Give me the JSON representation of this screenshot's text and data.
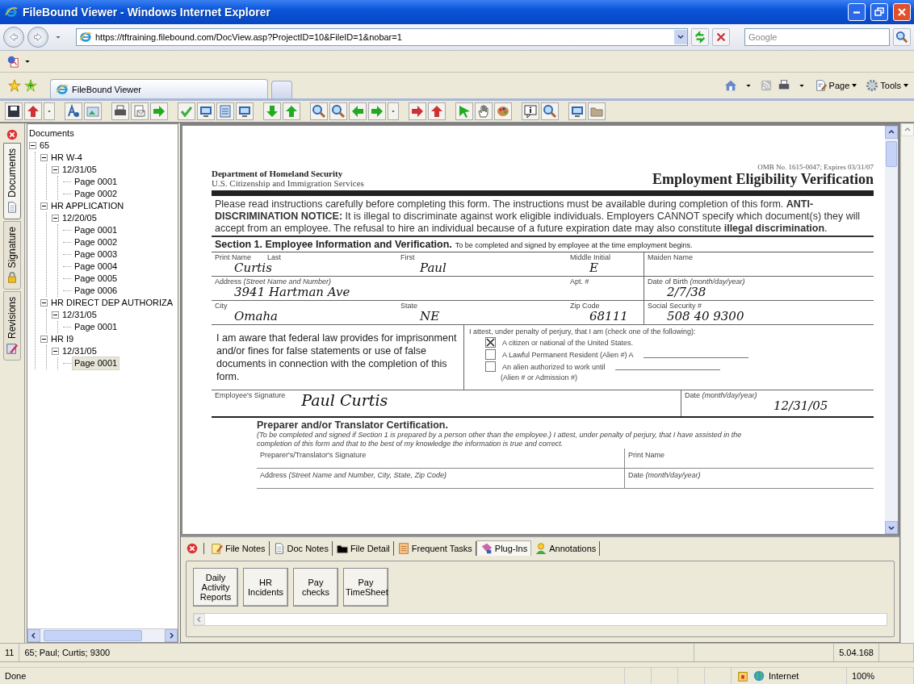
{
  "window": {
    "title": "FileBound Viewer - Windows Internet Explorer"
  },
  "address_bar": {
    "url": "https://tftraining.filebound.com/DocView.asp?ProjectID=10&FileID=1&nobar=1"
  },
  "search": {
    "placeholder": "Google"
  },
  "browser_tabs": [
    {
      "label": "FileBound Viewer",
      "selected": true
    }
  ],
  "command_bar": [
    {
      "label": "Page"
    },
    {
      "label": "Tools"
    }
  ],
  "side_tabs": [
    {
      "label": "Documents",
      "selected": true,
      "kind": "doc"
    },
    {
      "label": "Signature",
      "selected": false,
      "kind": "lock"
    },
    {
      "label": "Revisions",
      "selected": false,
      "kind": "pen"
    }
  ],
  "tree": {
    "title": "Documents",
    "items": [
      {
        "label": "65",
        "expanded": true,
        "children": [
          {
            "label": "HR W-4",
            "expanded": true,
            "children": [
              {
                "label": "12/31/05",
                "expanded": true,
                "children": [
                  {
                    "label": "Page 0001",
                    "selected": false
                  },
                  {
                    "label": "Page 0002",
                    "selected": false
                  }
                ]
              }
            ]
          },
          {
            "label": "HR APPLICATION",
            "expanded": true,
            "children": [
              {
                "label": "12/20/05",
                "expanded": true,
                "children": [
                  {
                    "label": "Page 0001",
                    "selected": false
                  },
                  {
                    "label": "Page 0002",
                    "selected": false
                  },
                  {
                    "label": "Page 0003",
                    "selected": false
                  },
                  {
                    "label": "Page 0004",
                    "selected": false
                  },
                  {
                    "label": "Page 0005",
                    "selected": false
                  },
                  {
                    "label": "Page 0006",
                    "selected": false
                  }
                ]
              }
            ]
          },
          {
            "label": "HR DIRECT DEP AUTHORIZA",
            "expanded": true,
            "children": [
              {
                "label": "12/31/05",
                "expanded": true,
                "children": [
                  {
                    "label": "Page 0001",
                    "selected": false
                  }
                ]
              }
            ]
          },
          {
            "label": "HR I9",
            "expanded": true,
            "children": [
              {
                "label": "12/31/05",
                "expanded": true,
                "children": [
                  {
                    "label": "Page 0001",
                    "selected": true
                  }
                ]
              }
            ]
          }
        ]
      }
    ]
  },
  "document": {
    "agency": "Department of Homeland Security",
    "bureau": "U.S. Citizenship and Immigration Services",
    "omb": "OMB No. 1615-0047; Expires 03/31/07",
    "title": "Employment Eligibility Verification",
    "instructions": "Please read instructions carefully before completing this form.  The instructions must be available during completion of this form.  **ANTI-DISCRIMINATION NOTICE:**  It is illegal to discriminate against work eligible individuals. Employers CANNOT specify which document(s) they will accept from an employee.  The refusal to hire an individual because of a future expiration date may also constitute **illegal discrimination**.",
    "section_title": "Section 1. Employee Information and Verification.",
    "section_note": "To be completed and signed by employee at the time employment begins.",
    "rows": [
      {
        "cells": [
          {
            "label": "Print Name",
            "sublabel": "Last",
            "value": "Curtis"
          },
          {
            "label": "First",
            "value": "Paul"
          },
          {
            "label": "Middle Initial",
            "value": "E"
          },
          {
            "label": "Maiden Name"
          }
        ]
      },
      {
        "cells": [
          {
            "label": "Address *(Street Name and Number)*",
            "value": "3941 Hartman Ave"
          },
          {},
          {
            "label": "Apt. #"
          },
          {
            "label": "Date of Birth *(month/day/year)*",
            "value": "2/7/38"
          }
        ]
      },
      {
        "cells": [
          {
            "label": "City",
            "value": "Omaha"
          },
          {
            "label": "State",
            "value": "NE"
          },
          {
            "label": "Zip Code",
            "value": "68111"
          },
          {
            "label": "Social Security #",
            "value": "508 40 9300"
          }
        ]
      }
    ],
    "awareness": "I am aware that federal law provides for imprisonment and/or fines for false statements or use of false documents in connection with the completion of this form.",
    "attest": "I attest, under penalty of perjury, that I am (check one of the following):",
    "options": [
      {
        "label": "A citizen or national of the United States.",
        "checked": true
      },
      {
        "label": "A Lawful Permanent Resident (Alien #) A",
        "checked": false
      },
      {
        "label": "An alien authorized to work until",
        "checked": false
      }
    ],
    "alien_note": "(Alien # or Admission #)",
    "signature_label": "Employee's Signature",
    "signature": "Paul Curtis",
    "date_label": "Date *(month/day/year)*",
    "date": "12/31/05",
    "preparer_title": "Preparer and/or Translator Certification.",
    "preparer_text": "(To be completed and signed if Section 1 is prepared by a person other than the employee.) I attest, under penalty of perjury, that I have assisted in the completion of this form and that to the best of my knowledge the information is true and correct.",
    "preparer_rows": [
      [
        "Preparer's/Translator's Signature",
        "Print Name"
      ],
      [
        "Address *(Street Name and Number, City, State, Zip Code)*",
        "Date *(month/day/year)*"
      ]
    ]
  },
  "bottom_tabs": [
    {
      "label": "File Notes",
      "selected": false,
      "kind": "notes"
    },
    {
      "label": "Doc Notes",
      "selected": false,
      "kind": "doc"
    },
    {
      "label": "File Detail",
      "selected": false,
      "kind": "folder"
    },
    {
      "label": "Frequent Tasks",
      "selected": false,
      "kind": "tasks"
    },
    {
      "label": "Plug-Ins",
      "selected": true,
      "kind": "plugin"
    },
    {
      "label": "Annotations",
      "selected": false,
      "kind": "person"
    }
  ],
  "plugin_buttons": [
    "Daily Activity Reports",
    "HR Incidents",
    "Pay checks",
    "Pay TimeSheet"
  ],
  "status_bar": {
    "record": "11",
    "summary": "65; Paul; Curtis; 9300",
    "version": "5.04.168"
  },
  "ie_status": {
    "text": "Done",
    "zone": "Internet",
    "zoom": "100%"
  }
}
